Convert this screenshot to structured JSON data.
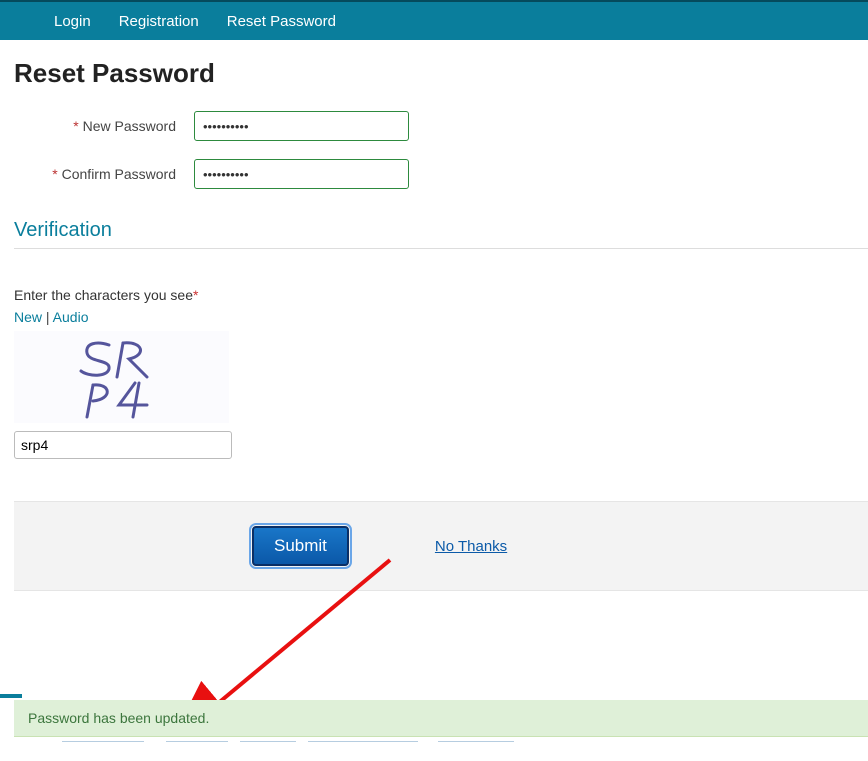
{
  "nav": {
    "login": "Login",
    "registration": "Registration",
    "reset": "Reset Password"
  },
  "page": {
    "title": "Reset Password"
  },
  "form": {
    "new_pw_label": "New Password",
    "confirm_pw_label": "Confirm Password",
    "new_pw_value": "••••••••••",
    "confirm_pw_value": "••••••••••"
  },
  "verification": {
    "heading": "Verification",
    "instruction": "Enter the characters you see",
    "link_new": "New",
    "link_audio": "Audio",
    "sep": " | ",
    "captcha_text": "SR P4",
    "input_value": "srp4"
  },
  "actions": {
    "submit": "Submit",
    "no_thanks": "No Thanks"
  },
  "status": {
    "success": "Password has been updated."
  }
}
